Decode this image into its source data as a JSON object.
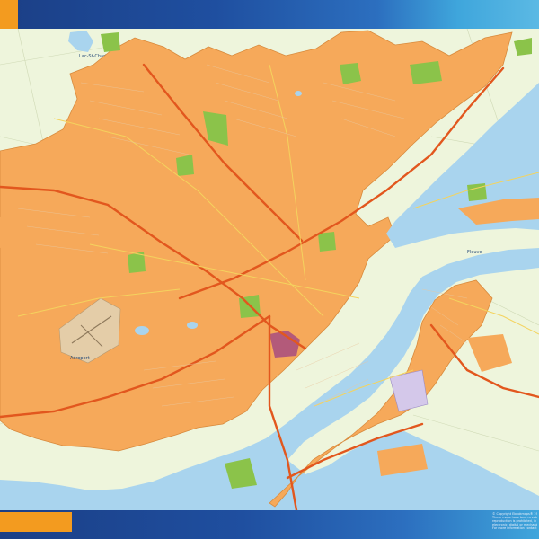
{
  "header": {
    "accent_color": "#f39b1f",
    "bar_color": "#1f4fa0"
  },
  "map": {
    "water_color": "#a9d4ee",
    "urban_color": "#f6a95a",
    "park_color": "#8bc34a",
    "land_color": "#eef5dc",
    "highway_color": "#e2571e",
    "road_color": "#f4d35e",
    "labels": {
      "lake": "Lac-St-Charles",
      "airport": "Aéroport",
      "river": "Fleuve"
    }
  },
  "footer": {
    "accent_color": "#f39b1f",
    "copyright_lines": [
      "© Copyright Ebookmaps® 1997-2017",
      "These maps have been created",
      "reproduction is prohibited, in any",
      "electronic, digital or mechanic",
      "For more information contact"
    ]
  }
}
